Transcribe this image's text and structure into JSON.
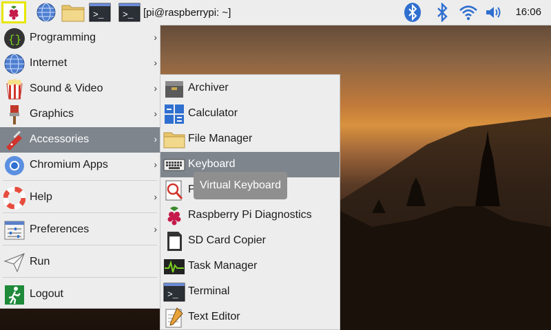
{
  "taskbar": {
    "terminal_task_title": "[pi@raspberrypi: ~]",
    "clock": "16:06",
    "launchers": [
      "menu-icon",
      "browser-icon",
      "file-manager-icon",
      "terminal-icon"
    ],
    "tray": [
      "bluetooth-icon",
      "bluetooth-icon",
      "wifi-icon",
      "volume-icon"
    ]
  },
  "menu": {
    "items": [
      {
        "label": "Programming",
        "icon": "programming-icon"
      },
      {
        "label": "Internet",
        "icon": "internet-icon"
      },
      {
        "label": "Sound & Video",
        "icon": "sound-video-icon"
      },
      {
        "label": "Graphics",
        "icon": "graphics-icon"
      },
      {
        "label": "Accessories",
        "icon": "accessories-icon",
        "selected": true
      },
      {
        "label": "Chromium Apps",
        "icon": "chromium-icon"
      },
      {
        "label": "Help",
        "icon": "help-icon"
      },
      {
        "label": "Preferences",
        "icon": "preferences-icon"
      },
      {
        "label": "Run",
        "icon": "run-icon"
      },
      {
        "label": "Logout",
        "icon": "logout-icon"
      }
    ]
  },
  "submenu": {
    "items": [
      {
        "label": "Archiver",
        "icon": "archiver-icon"
      },
      {
        "label": "Calculator",
        "icon": "calculator-icon"
      },
      {
        "label": "File Manager",
        "icon": "folder-icon"
      },
      {
        "label": "Keyboard",
        "icon": "keyboard-icon",
        "selected": true
      },
      {
        "label": "P",
        "icon": "pdf-viewer-icon"
      },
      {
        "label": "Raspberry Pi Diagnostics",
        "icon": "raspberry-icon"
      },
      {
        "label": "SD Card Copier",
        "icon": "sd-card-icon"
      },
      {
        "label": "Task Manager",
        "icon": "task-manager-icon"
      },
      {
        "label": "Terminal",
        "icon": "terminal-icon"
      },
      {
        "label": "Text Editor",
        "icon": "text-editor-icon"
      }
    ]
  },
  "tooltip": "Virtual Keyboard"
}
